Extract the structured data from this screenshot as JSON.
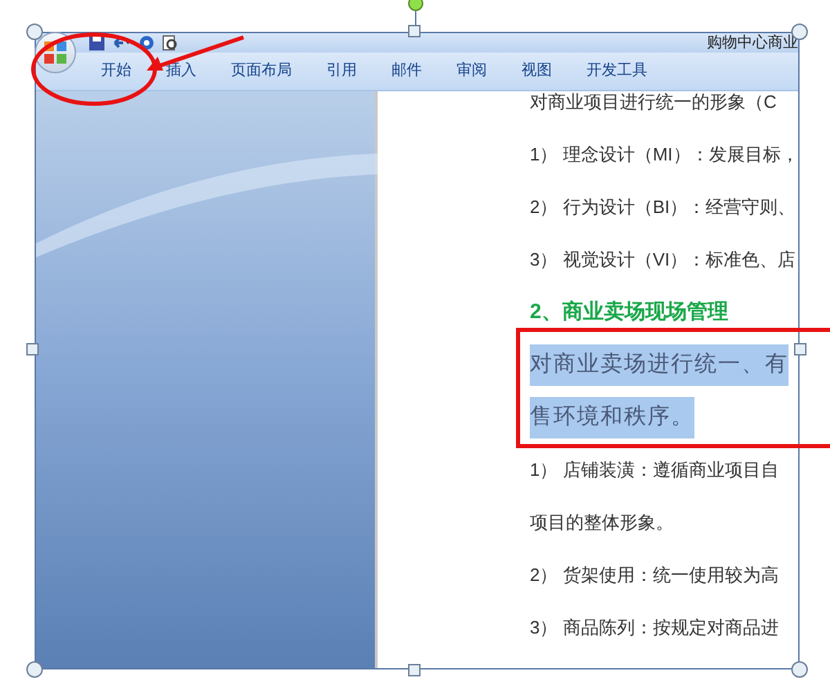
{
  "window": {
    "title": "购物中心商业"
  },
  "ribbon": {
    "tabs": [
      {
        "label": "开始"
      },
      {
        "label": "插入"
      },
      {
        "label": "页面布局"
      },
      {
        "label": "引用"
      },
      {
        "label": "邮件"
      },
      {
        "label": "审阅"
      },
      {
        "label": "视图"
      },
      {
        "label": "开发工具"
      }
    ]
  },
  "document": {
    "paragraphs": [
      {
        "kind": "text",
        "text": "对商业项目进行统一的形象（C"
      },
      {
        "kind": "text",
        "text": "1） 理念设计（MI）：发展目标，"
      },
      {
        "kind": "text",
        "text": "2） 行为设计（BI）：经营守则、"
      },
      {
        "kind": "text",
        "text": "3） 视觉设计（VI）：标准色、店"
      },
      {
        "kind": "heading",
        "text": "2、商业卖场现场管理"
      },
      {
        "kind": "highlight",
        "text": "对商业卖场进行统一、有"
      },
      {
        "kind": "highlight",
        "text": "售环境和秩序。"
      },
      {
        "kind": "text",
        "text": "1） 店铺装潢：遵循商业项目自"
      },
      {
        "kind": "text",
        "text": "项目的整体形象。"
      },
      {
        "kind": "text",
        "text": "2） 货架使用：统一使用较为高"
      },
      {
        "kind": "text",
        "text": "3） 商品陈列：按规定对商品进"
      }
    ]
  }
}
